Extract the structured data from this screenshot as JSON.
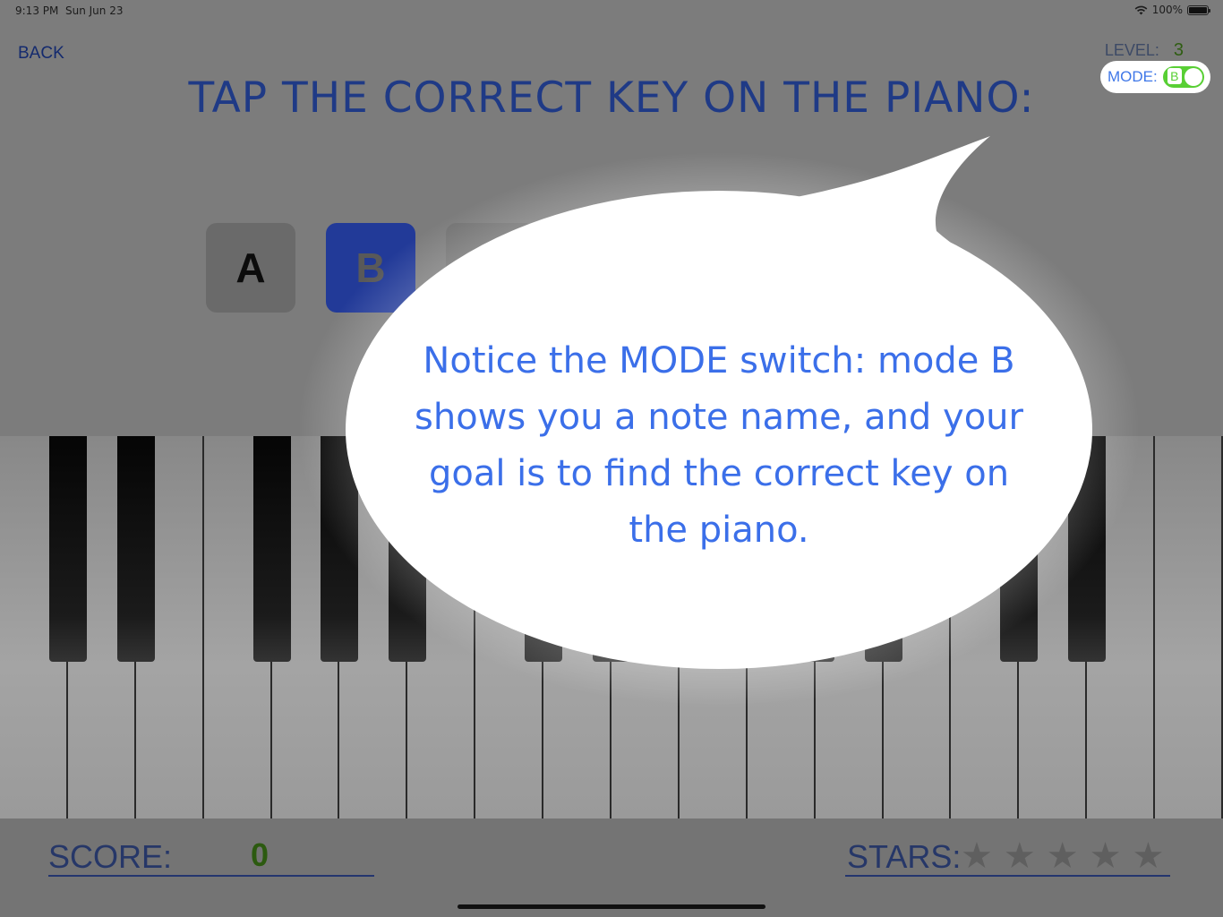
{
  "status_bar": {
    "time": "9:13 PM",
    "date": "Sun Jun 23",
    "battery": "100%",
    "wifi_icon": "wifi-icon",
    "battery_icon": "battery-icon"
  },
  "nav": {
    "back_label": "BACK"
  },
  "level": {
    "label": "LEVEL:",
    "value": "3"
  },
  "mode": {
    "label": "MODE:",
    "toggle_letter": "B",
    "toggle_on": true,
    "toggle_color": "#58cf34"
  },
  "instruction": "TAP THE CORRECT KEY ON THE PIANO:",
  "note_buttons": [
    {
      "label": "A",
      "state": "normal"
    },
    {
      "label": "B",
      "state": "selected"
    }
  ],
  "piano": {
    "white_key_count": 18
  },
  "score": {
    "label": "SCORE:",
    "value": "0"
  },
  "stars": {
    "label": "STARS:",
    "total": 5,
    "earned": 0,
    "icon": "star-icon"
  },
  "tutorial_bubble": {
    "text": "Notice the MODE switch: mode B shows you a note name, and your goal is to find the correct key on the piano.",
    "text_color": "#3b6fe9"
  },
  "colors": {
    "accent": "#3b6fe9",
    "selected_note": "#223a98",
    "score_value": "#2c5a10"
  }
}
